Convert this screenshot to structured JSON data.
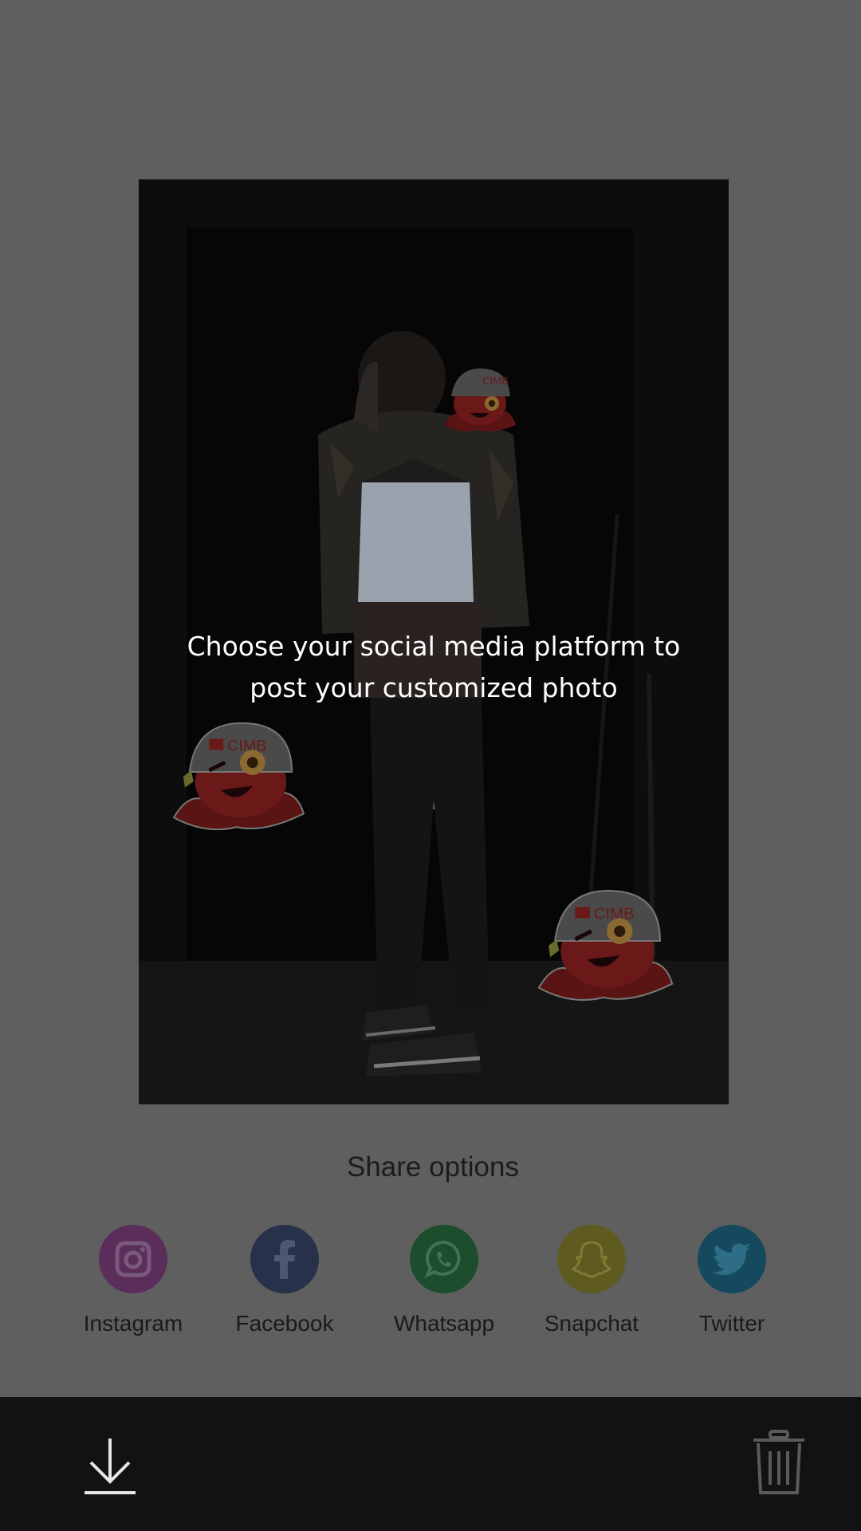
{
  "overlay": {
    "message_line1": "Choose your social media platform to",
    "message_line2": "post your customized photo"
  },
  "photo": {
    "stickers": [
      {
        "icon": "octopus-mascot-sticker",
        "badge_text": "CIMB"
      },
      {
        "icon": "octopus-mascot-sticker",
        "badge_text": "CIMB"
      },
      {
        "icon": "octopus-mascot-sticker",
        "badge_text": "CIMB"
      }
    ]
  },
  "share": {
    "title": "Share options",
    "options": [
      {
        "label": "Instagram",
        "icon": "instagram-icon",
        "color": "#5a2d5a"
      },
      {
        "label": "Facebook",
        "icon": "facebook-icon",
        "color": "#27324a"
      },
      {
        "label": "Whatsapp",
        "icon": "whatsapp-icon",
        "color": "#1c4d2d"
      },
      {
        "label": "Snapchat",
        "icon": "snapchat-icon",
        "color": "#5f5a1f"
      },
      {
        "label": "Twitter",
        "icon": "twitter-icon",
        "color": "#154a5e"
      }
    ]
  },
  "toolbar": {
    "download_icon": "download-icon",
    "delete_icon": "trash-icon"
  },
  "colors": {
    "dim_background": "#5f5f5f",
    "bottom_bar": "#121212"
  }
}
